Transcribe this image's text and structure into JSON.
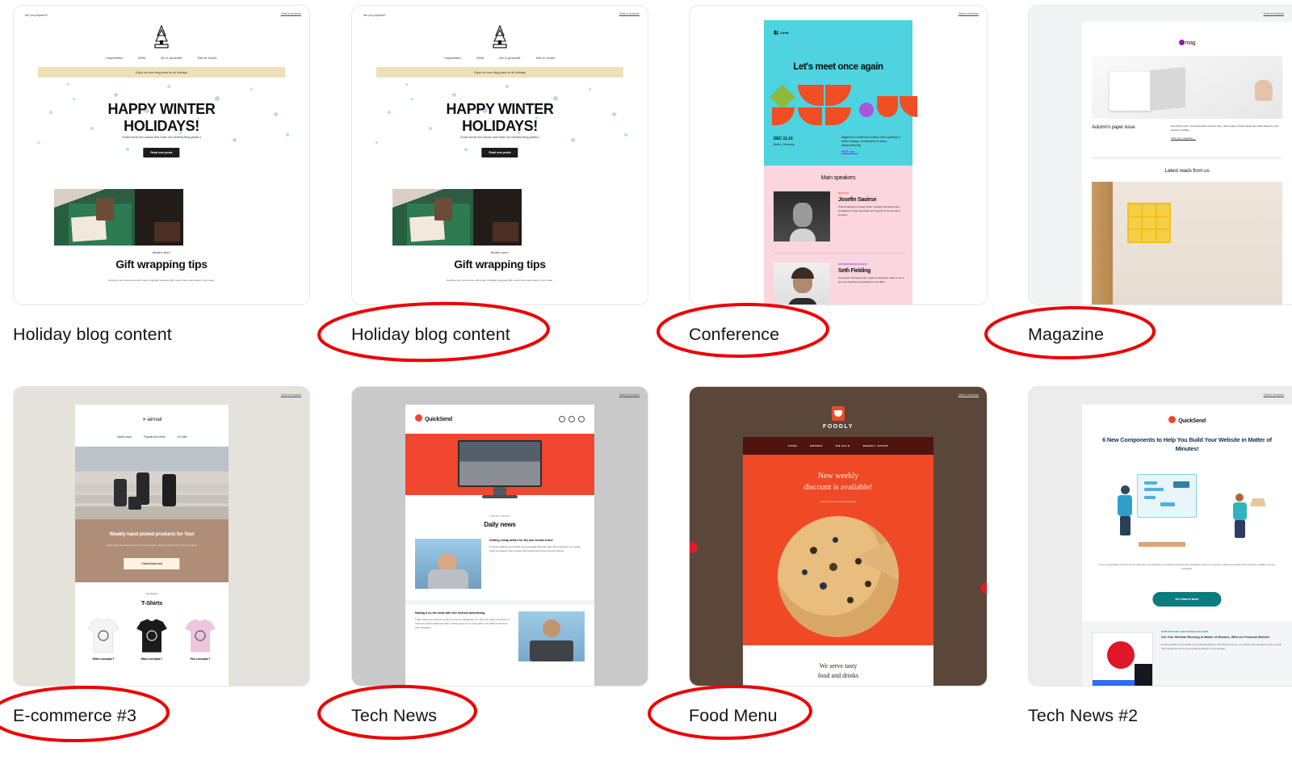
{
  "gallery": {
    "columns": 4,
    "rows": 2,
    "cards": [
      {
        "id": "holiday-blog-content-1",
        "label": "Holiday blog content",
        "annotated": false,
        "preview": {
          "kind": "holiday-blog",
          "view_in_browser": "View in browser",
          "nav": [
            "Inspiration",
            "Gifts",
            "Do it yourself",
            "Get in touch"
          ],
          "banner": "Enjoy our new blog posts for all holidays",
          "headline_line1": "HAPPY WINTER",
          "headline_line2": "HOLIDAYS!",
          "subhead": "Grab some hot cocoa and read our newest blog posts:)",
          "button": "Read new posts",
          "kicker": "What's new?",
          "article_title": "Gift wrapping tips",
          "article_text": "Surprise your loved ones with small, originally wrapped gifts. Learn here easy &amp; cozy make."
        }
      },
      {
        "id": "holiday-blog-content-2",
        "label": "Holiday blog content",
        "annotated": true,
        "preview": {
          "kind": "holiday-blog",
          "view_in_browser": "View in browser",
          "nav": [
            "Inspiration",
            "Gifts",
            "Do it yourself",
            "Get in touch"
          ],
          "banner": "Enjoy our new blog posts for all holidays",
          "headline_line1": "HAPPY WINTER",
          "headline_line2": "HOLIDAYS!",
          "subhead": "Grab some hot cocoa and read our newest blog posts:)",
          "button": "Read new posts",
          "kicker": "What's new?",
          "article_title": "Gift wrapping tips",
          "article_text": "Surprise your loved ones with small, originally wrapped gifts. Learn here easy &amp; cozy make."
        }
      },
      {
        "id": "conference",
        "label": "Conference",
        "annotated": true,
        "preview": {
          "kind": "conference",
          "view_in_browser": "View in browser",
          "logo": "Conff",
          "headline": "Let's meet once again",
          "date": "DEC 11-14",
          "location": "Berlin, Germany",
          "description": "Biggest tech conference in Berlin. Meet speakers in areas of design, development, AI &amp; entrepreneurship.",
          "link": "RSVP now →",
          "speakers_title": "Main speakers",
          "speakers": [
            {
              "kicker": "DESIGN",
              "name": "Josefin Saoirse",
              "bio": "Product designer at Antarp Team. Josephin will present key foundations of user interviews and research on E-commerce products."
            },
            {
              "kicker": "ENTREPRENEURSHIP",
              "name": "Seth Fielding",
              "bio": "Co-founder of Protech and 7 years of experience. Seth is one of the most inspiring young leaders in tech field."
            }
          ]
        }
      },
      {
        "id": "magazine",
        "label": "Magazine",
        "annotated": true,
        "preview": {
          "kind": "magazine",
          "view_in_browser": "View in browser",
          "logo": "mag",
          "feature_title": "Autumn's paper issue",
          "feature_text": "Hot off the press. Our November's issue is here. New recipes, interior ideas and travel ideas for your autumn's holiday.",
          "feature_link": "Grab your magazine →",
          "section_title": "Latest reads from us"
        }
      },
      {
        "id": "e-commerce-3",
        "label": "E-commerce #3",
        "annotated": true,
        "preview": {
          "kind": "ecommerce",
          "view_in_browser": "View in browser",
          "logo": "airmail",
          "nav": [
            "Latest news",
            "Popular this week",
            "On sale"
          ],
          "band_title": "Weekly hand picked products for You!",
          "band_text": "Every week we collect some of our most popular products delivered for You every week",
          "band_button": "Check them out",
          "kicker": "Top Sellers",
          "section_title": "T-Shirts",
          "products": [
            {
              "name": "White Loremipsk T",
              "color": "#f4f4f4"
            },
            {
              "name": "Black Loremipsk T",
              "color": "#1b1b1b"
            },
            {
              "name": "Pink Loremipsk T",
              "color": "#edc6dd"
            }
          ]
        }
      },
      {
        "id": "tech-news",
        "label": "Tech News",
        "annotated": true,
        "preview": {
          "kind": "technews",
          "view_in_browser": "View in browser",
          "logo": "QuickSend",
          "kicker": "FRESH NEWS",
          "section_title": "Daily news",
          "articles": [
            {
              "title": "Getting cheap airfare for the last minute travel",
              "text": "Ut harum quidem rerum facilis est et expedita distinctio. Nam libero tempore, cum soluta nobis est eligendi optio cumque nihil impedit quo minus id quod maxime."
            },
            {
              "title": "Nailing it on the head with free internet advertising",
              "text": "These cases are perfectly simple and easy to distinguish. In a free hour, when our power of choice is untrammelled and when nothing prevents our being able to do what we like best, every pleasure."
            }
          ]
        }
      },
      {
        "id": "food-menu",
        "label": "Food Menu",
        "annotated": true,
        "preview": {
          "kind": "foodmenu",
          "view_in_browser": "View in browser",
          "logo": "FOODLY",
          "nav": [
            "FOOD",
            "DRINKS",
            "ON SALE",
            "WEEKLY OFFER"
          ],
          "headline_line1": "New weekly",
          "headline_line2": "discount is available!",
          "sub": "Check out our brand new discount",
          "footer_line1": "We serve tasty",
          "footer_line2": "food and drinks"
        }
      },
      {
        "id": "tech-news-2",
        "label": "Tech News #2",
        "annotated": false,
        "preview": {
          "kind": "technews2",
          "view_in_browser": "View in browser",
          "logo": "QuickSend",
          "headline": "6 New Components to Help You Build Your Website in Matter of Minutes!",
          "body": "Sed ut perspiciatis unde omnis iste natus error sit voluptatem accusantium doloremque laudantium totam rem aperiam, eaque ipsa quae ab illo inventore veritatis et quasi architecto.",
          "button": "Get Started Now!",
          "promo_kicker": "INTRODUCING QUICKSEND BUILDER",
          "promo_title": "Get Your Website Running in Matter of Minutes, With our Powerful Builder!",
          "promo_text": "Et harum quidem rerum facilis est et expedita distinctio. Nam libero tempore, cum soluta nobis est eligendi optio cumque nihil impedit quo minus id quod maxime placeat, omnis voluptas."
        }
      }
    ]
  },
  "annotations": {
    "stroke_color": "#ee0000",
    "stroke_width": 4,
    "shape": "ellipse",
    "targets": [
      "Holiday blog content",
      "Conference",
      "Magazine",
      "E-commerce #3",
      "Tech News",
      "Food Menu"
    ]
  },
  "colors": {
    "page_background": "#ffffff",
    "label_text": "#151515",
    "card_border": "#e4e6e8",
    "annotation_red": "#ee0000"
  }
}
